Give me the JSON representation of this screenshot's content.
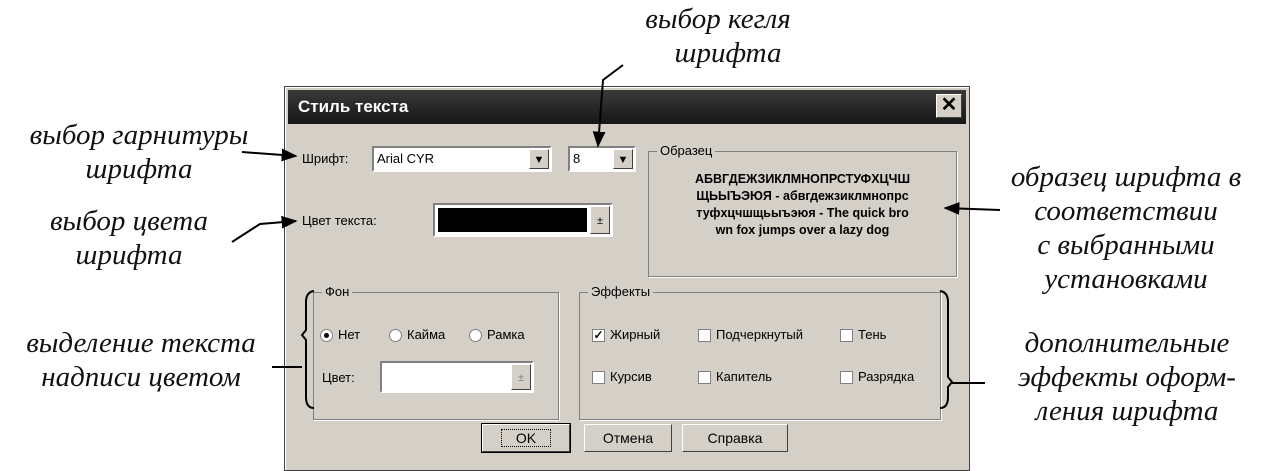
{
  "annotations": {
    "font_size": [
      "выбор кегля",
      "шрифта"
    ],
    "typeface": [
      "выбор гарнитуры",
      "шрифта"
    ],
    "text_color": [
      "выбор цвета",
      "шрифта"
    ],
    "highlight": [
      "выделение текста",
      "надписи цветом"
    ],
    "sample": [
      "образец шрифта в",
      "соответствии",
      "с выбранными",
      "установками"
    ],
    "effects": [
      "дополнительные",
      "эффекты оформ-",
      "ления шрифта"
    ]
  },
  "dialog": {
    "title": "Стиль текста",
    "close_glyph": "✕",
    "font_label": "Шрифт:",
    "font_value": "Arial CYR",
    "size_value": "8",
    "color_label": "Цвет текста:",
    "color_value": "#000000",
    "sample_group": "Образец",
    "sample_lines": [
      "АБВГДЕЖЗИКЛМНОПРСТУФХЦЧШ",
      "ЩЬЫЪЭЮЯ - абвгдежзиклмнопрс",
      "туфхцчшщьыъэюя - The quick bro",
      "wn fox jumps over a lazy dog"
    ],
    "bg_group": "Фон",
    "radio_none": "Нет",
    "radio_border": "Кайма",
    "radio_frame": "Рамка",
    "bg_color_label": "Цвет:",
    "effects_group": "Эффекты",
    "bold": "Жирный",
    "underline": "Подчеркнутый",
    "shadow": "Тень",
    "italic": "Курсив",
    "smallcaps": "Капитель",
    "spacing": "Разрядка",
    "ok": "OK",
    "cancel": "Отмена",
    "help": "Справка"
  }
}
